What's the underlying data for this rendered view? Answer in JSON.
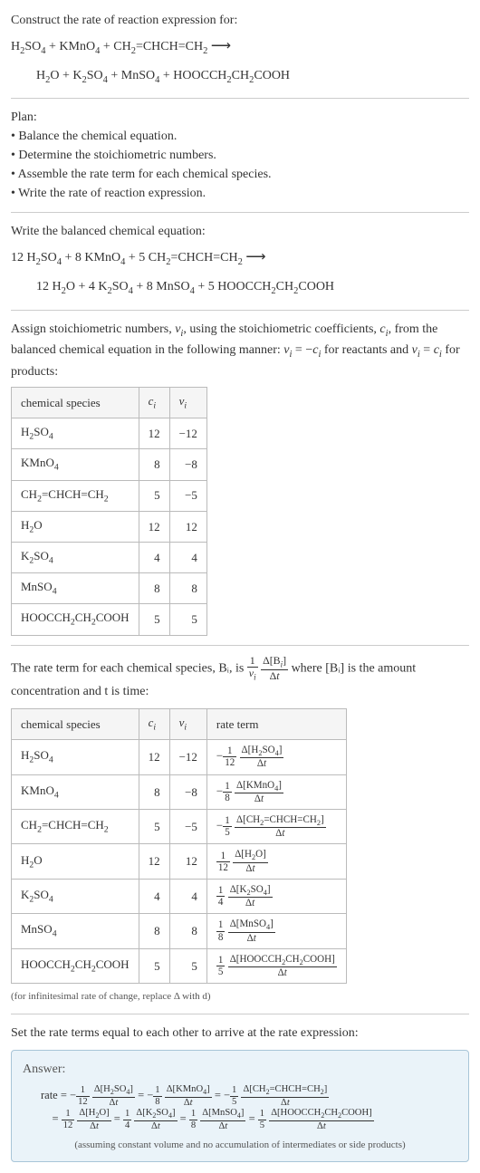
{
  "intro": {
    "prompt": "Construct the rate of reaction expression for:",
    "reactants_line": "H₂SO₄ + KMnO₄ + CH₂=CHCH=CH₂ ⟶",
    "products_line": "H₂O + K₂SO₄ + MnSO₄ + HOOCCH₂CH₂COOH"
  },
  "plan": {
    "heading": "Plan:",
    "items": [
      "Balance the chemical equation.",
      "Determine the stoichiometric numbers.",
      "Assemble the rate term for each chemical species.",
      "Write the rate of reaction expression."
    ]
  },
  "balanced": {
    "heading": "Write the balanced chemical equation:",
    "reactants_line": "12 H₂SO₄ + 8 KMnO₄ + 5 CH₂=CHCH=CH₂ ⟶",
    "products_line": "12 H₂O + 4 K₂SO₄ + 8 MnSO₄ + 5 HOOCCH₂CH₂COOH"
  },
  "stoich": {
    "text_before": "Assign stoichiometric numbers, νᵢ, using the stoichiometric coefficients, cᵢ, from the balanced chemical equation in the following manner: νᵢ = −cᵢ for reactants and νᵢ = cᵢ for products:",
    "headers": [
      "chemical species",
      "cᵢ",
      "νᵢ"
    ],
    "rows": [
      {
        "species": "H₂SO₄",
        "c": "12",
        "v": "−12"
      },
      {
        "species": "KMnO₄",
        "c": "8",
        "v": "−8"
      },
      {
        "species": "CH₂=CHCH=CH₂",
        "c": "5",
        "v": "−5"
      },
      {
        "species": "H₂O",
        "c": "12",
        "v": "12"
      },
      {
        "species": "K₂SO₄",
        "c": "4",
        "v": "4"
      },
      {
        "species": "MnSO₄",
        "c": "8",
        "v": "8"
      },
      {
        "species": "HOOCCH₂CH₂COOH",
        "c": "5",
        "v": "5"
      }
    ]
  },
  "rate_intro": {
    "text_a": "The rate term for each chemical species, Bᵢ, is ",
    "text_b": " where [Bᵢ] is the amount concentration and t is time:"
  },
  "rate_table": {
    "headers": [
      "chemical species",
      "cᵢ",
      "νᵢ",
      "rate term"
    ],
    "rows": [
      {
        "species": "H₂SO₄",
        "c": "12",
        "v": "−12",
        "sign": "−",
        "coef_num": "1",
        "coef_den": "12",
        "delta": "Δ[H₂SO₄]"
      },
      {
        "species": "KMnO₄",
        "c": "8",
        "v": "−8",
        "sign": "−",
        "coef_num": "1",
        "coef_den": "8",
        "delta": "Δ[KMnO₄]"
      },
      {
        "species": "CH₂=CHCH=CH₂",
        "c": "5",
        "v": "−5",
        "sign": "−",
        "coef_num": "1",
        "coef_den": "5",
        "delta": "Δ[CH₂=CHCH=CH₂]"
      },
      {
        "species": "H₂O",
        "c": "12",
        "v": "12",
        "sign": "",
        "coef_num": "1",
        "coef_den": "12",
        "delta": "Δ[H₂O]"
      },
      {
        "species": "K₂SO₄",
        "c": "4",
        "v": "4",
        "sign": "",
        "coef_num": "1",
        "coef_den": "4",
        "delta": "Δ[K₂SO₄]"
      },
      {
        "species": "MnSO₄",
        "c": "8",
        "v": "8",
        "sign": "",
        "coef_num": "1",
        "coef_den": "8",
        "delta": "Δ[MnSO₄]"
      },
      {
        "species": "HOOCCH₂CH₂COOH",
        "c": "5",
        "v": "5",
        "sign": "",
        "coef_num": "1",
        "coef_den": "5",
        "delta": "Δ[HOOCCH₂CH₂COOH]"
      }
    ],
    "note": "(for infinitesimal rate of change, replace Δ with d)"
  },
  "final": {
    "heading": "Set the rate terms equal to each other to arrive at the rate expression:"
  },
  "answer": {
    "label": "Answer:",
    "note": "(assuming constant volume and no accumulation of intermediates or side products)"
  }
}
